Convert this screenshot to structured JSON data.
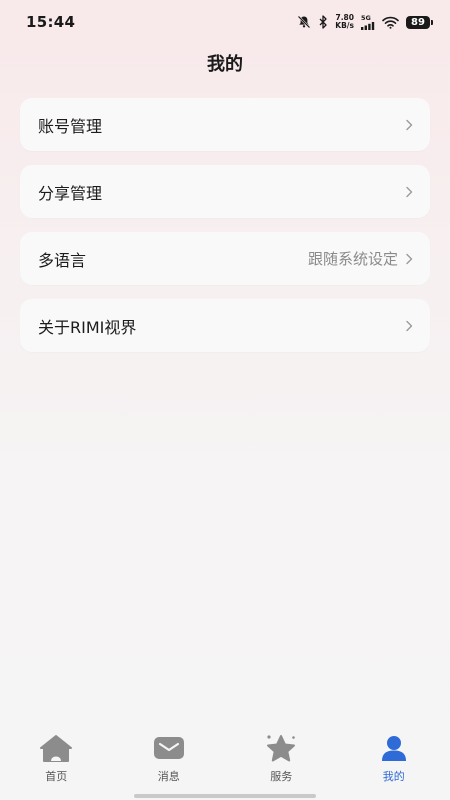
{
  "status": {
    "time": "15:44",
    "net_speed_value": "7.80",
    "net_speed_unit": "KB/s",
    "network": "5G",
    "battery": "89"
  },
  "header": {
    "title": "我的"
  },
  "menu": [
    {
      "label": "账号管理",
      "value": ""
    },
    {
      "label": "分享管理",
      "value": ""
    },
    {
      "label": "多语言",
      "value": "跟随系统设定"
    },
    {
      "label": "关于RIMI视界",
      "value": ""
    }
  ],
  "tabs": [
    {
      "label": "首页",
      "icon": "home-icon",
      "active": false
    },
    {
      "label": "消息",
      "icon": "mail-icon",
      "active": false
    },
    {
      "label": "服务",
      "icon": "star-icon",
      "active": false
    },
    {
      "label": "我的",
      "icon": "person-icon",
      "active": true
    }
  ],
  "colors": {
    "accent": "#2f6bd6",
    "icon_gray": "#8c8c8c",
    "text": "#1a1a1a",
    "muted": "#8a8a8a"
  }
}
